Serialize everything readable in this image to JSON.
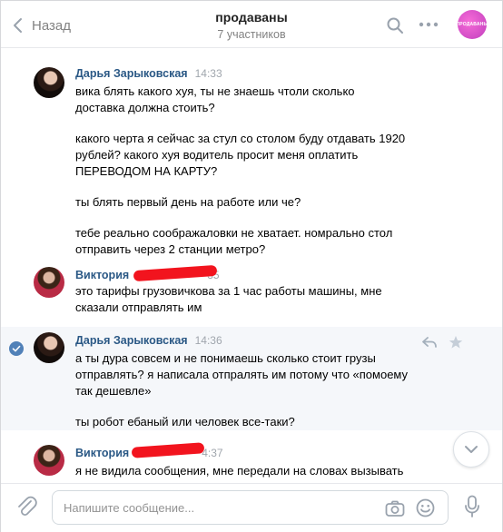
{
  "header": {
    "back_label": "Назад",
    "title": "продаваны",
    "subtitle": "7 участников"
  },
  "messages": [
    {
      "author": "Дарья Зарыковская",
      "time": "14:33",
      "avatar": "avatar-dasha",
      "paragraphs": [
        [
          "вика блять какого хуя, ты не знаешь чтоли сколько",
          "доставка должна стоить?"
        ],
        [
          "какого черта я сейчас за стул со столом буду отдавать 1920",
          "рублей? какого хуя водитель просит меня оплатить",
          "ПЕРЕВОДОМ НА КАРТУ?"
        ],
        [
          "ты блять первый день на работе или че?"
        ],
        [
          "тебе реально соображаловки не хватает. номрально стол",
          "отправить через 2 станции метро?"
        ]
      ]
    },
    {
      "author": "Виктория",
      "time": "35",
      "avatar": "avatar-vika",
      "paragraphs": [
        [
          "это тарифы грузовичкова за 1 час работы машины, мне",
          "сказали отправлять им"
        ]
      ]
    },
    {
      "author": "Дарья Зарыковская",
      "time": "14:36",
      "avatar": "avatar-dasha",
      "paragraphs": [
        [
          "а ты дура совсем и не понимаешь сколько стоит грузы",
          "отправлять? я написала отпралять им потому что «помоему",
          "так дешевле»"
        ],
        [
          "ты робот ебаный или человек все-таки?"
        ]
      ]
    },
    {
      "author": "Виктория",
      "time": "4:37",
      "avatar": "avatar-vika",
      "paragraphs": [
        [
          "я не видила сообщения, мне передали на словах вызывать"
        ]
      ]
    }
  ],
  "composer": {
    "placeholder": "Напишите сообщение..."
  },
  "colors": {
    "author": "#2a5885",
    "time": "#a0a6ad",
    "accent": "#5181b8",
    "redaction": "#f2141e"
  },
  "icons": [
    "chevron-left-icon",
    "search-icon",
    "more-icon",
    "check-icon",
    "reply-icon",
    "star-icon",
    "chevron-down-icon",
    "paperclip-icon",
    "camera-icon",
    "smile-icon",
    "microphone-icon"
  ]
}
